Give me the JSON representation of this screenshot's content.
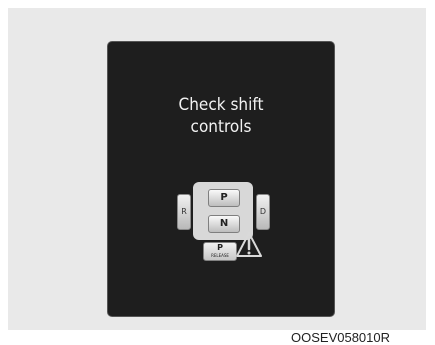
{
  "display": {
    "message_line1": "Check shift",
    "message_line2": "controls"
  },
  "shifter": {
    "r_label": "R",
    "d_label": "D",
    "p_label": "P",
    "n_label": "N",
    "release_p": "P",
    "release_text": "RELEASE"
  },
  "warning_icon": "warning-triangle-icon",
  "caption": "OOSEV058010R"
}
